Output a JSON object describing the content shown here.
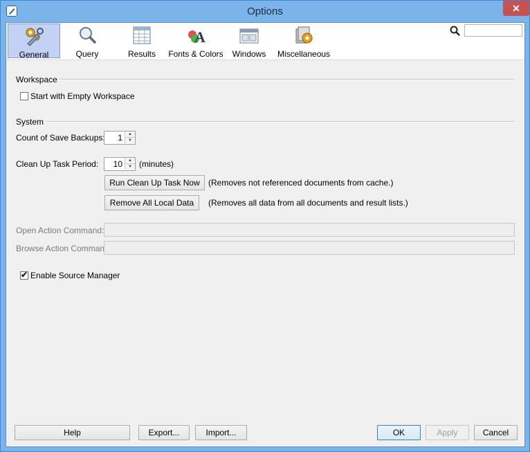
{
  "window": {
    "title": "Options",
    "close_glyph": "✕"
  },
  "toolbar": {
    "tabs": [
      {
        "label": "General",
        "icon": "gears-wrench-icon",
        "active": true
      },
      {
        "label": "Query",
        "icon": "magnifier-icon",
        "active": false
      },
      {
        "label": "Results",
        "icon": "table-icon",
        "active": false
      },
      {
        "label": "Fonts & Colors",
        "icon": "font-palette-icon",
        "active": false
      },
      {
        "label": "Windows",
        "icon": "windows-icon",
        "active": false
      },
      {
        "label": "Miscellaneous",
        "icon": "misc-gear-icon",
        "active": false
      }
    ],
    "search": {
      "placeholder": "",
      "value": ""
    }
  },
  "workspace": {
    "heading": "Workspace",
    "start_empty_label": "Start with Empty Workspace",
    "start_empty_checked": false
  },
  "system": {
    "heading": "System",
    "save_backups_label": "Count of Save Backups:",
    "save_backups_value": "1",
    "cleanup_label": "Clean Up Task Period:",
    "cleanup_value": "10",
    "cleanup_unit": "(minutes)",
    "run_cleanup_button": "Run Clean Up Task Now",
    "run_cleanup_desc": "(Removes not referenced documents from cache.)",
    "remove_local_button": "Remove All Local Data",
    "remove_local_desc": "(Removes all data from all documents and result lists.)",
    "open_action_label": "Open Action Command:",
    "open_action_value": "",
    "browse_action_label": "Browse Action Command:",
    "browse_action_value": "",
    "source_manager_label": "Enable Source Manager",
    "source_manager_checked": true
  },
  "footer": {
    "help": "Help",
    "export": "Export...",
    "import": "Import...",
    "ok": "OK",
    "apply": "Apply",
    "cancel": "Cancel"
  },
  "colors": {
    "titlebar": "#7ab4ea",
    "close": "#c75050",
    "active_tab": "#c3d1f5"
  }
}
